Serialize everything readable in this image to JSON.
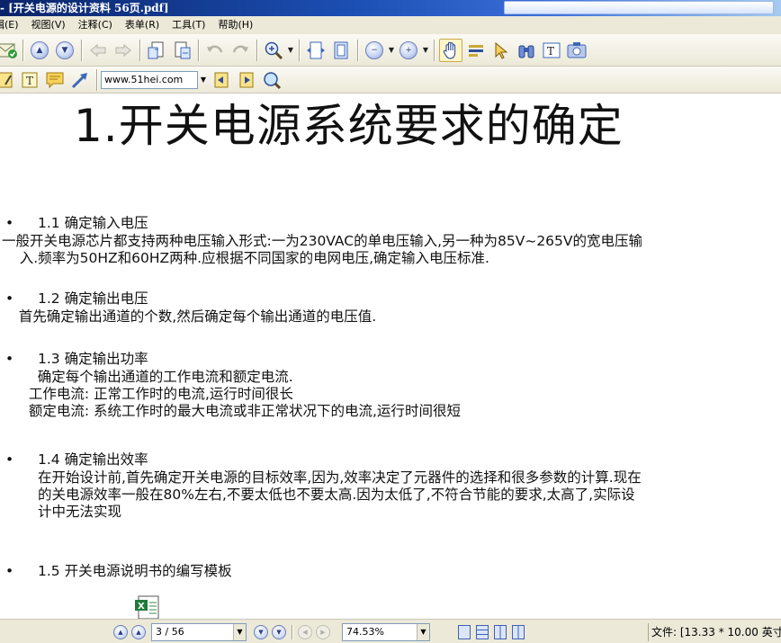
{
  "window": {
    "title": "- [开关电源的设计资料 56页.pdf]"
  },
  "menu": {
    "items": [
      "辑(E)",
      "视图(V)",
      "注释(C)",
      "表单(R)",
      "工具(T)",
      "帮助(H)"
    ]
  },
  "toolbar1": {
    "icons": [
      "email-icon",
      "page-up-icon",
      "page-down-icon",
      "back-icon",
      "forward-icon",
      "extract-page-icon",
      "insert-page-icon",
      "undo-icon",
      "redo-icon",
      "zoom-in-icon",
      "fit-width-icon",
      "fit-page-icon",
      "zoom-out-circle-icon",
      "zoom-in-circle-icon",
      "hand-tool-icon",
      "select-text-icon",
      "pointer-icon",
      "binoculars-icon",
      "text-box-icon",
      "snapshot-icon"
    ]
  },
  "toolbar2": {
    "url": "www.51hei.com",
    "icons": [
      "note-icon",
      "typewriter-icon",
      "comment-icon",
      "arrow-icon",
      "prev-view-icon",
      "next-view-icon",
      "search-web-icon"
    ]
  },
  "document": {
    "title": "1.开关电源系统要求的确定",
    "sections": [
      {
        "heading": "1.1 确定输入电压",
        "body": "一般开关电源芯片都支持两种电压输入形式:一为230VAC的单电压输入,另一种为85V~265V的宽电压输\n    入.频率为50HZ和60HZ两种.应根据不同国家的电网电压,确定输入电压标准."
      },
      {
        "heading": "1.2 确定输出电压",
        "body": "   首先确定输出通道的个数,然后确定每个输出通道的电压值."
      },
      {
        "heading": "1.3 确定输出功率",
        "body": "    确定每个输出通道的工作电流和额定电流.\n  工作电流: 正常工作时的电流,运行时间很长\n  额定电流: 系统工作时的最大电流或非正常状况下的电流,运行时间很短"
      },
      {
        "heading": "1.4 确定输出效率",
        "body": "在开始设计前,首先确定开关电源的目标效率,因为,效率决定了元器件的选择和很多参数的计算.现在\n的关电源效率一般在80%左右,不要太低也不要太高.因为太低了,不符合节能的要求,太高了,实际设\n计中无法实现"
      },
      {
        "heading": "1.5 开关电源说明书的编写模板",
        "body": ""
      }
    ],
    "bullet": "•"
  },
  "statusbar": {
    "page": "3 / 56",
    "zoom": "74.53%",
    "file_info": "文件: [13.33 * 10.00 英寸"
  }
}
